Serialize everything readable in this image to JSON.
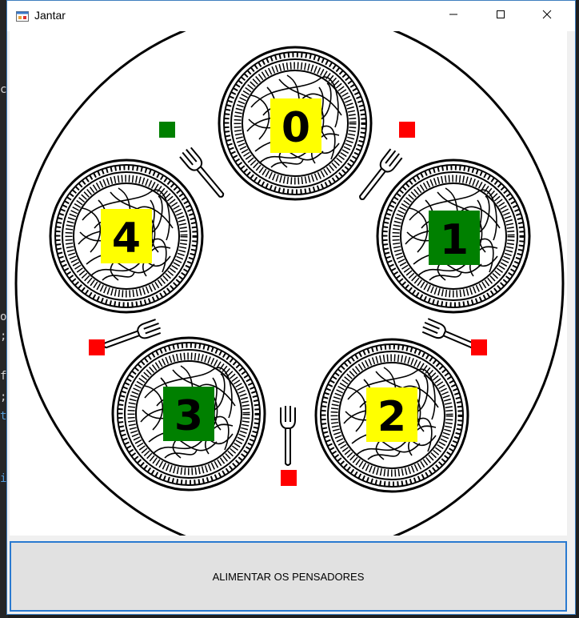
{
  "window": {
    "title": "Jantar",
    "app_icon": "winforms-app-icon",
    "controls": [
      "minimize-icon",
      "maximize-icon",
      "close-icon"
    ]
  },
  "background_editor": {
    "visible_chars": [
      "c",
      "o",
      ";",
      "f",
      ";",
      "t",
      "i"
    ]
  },
  "table": {
    "philosophers": [
      {
        "id": "0",
        "label": "0",
        "state_color": "#ffff00",
        "text_color": "#000000"
      },
      {
        "id": "1",
        "label": "1",
        "state_color": "#008000",
        "text_color": "#000000"
      },
      {
        "id": "2",
        "label": "2",
        "state_color": "#ffff00",
        "text_color": "#000000"
      },
      {
        "id": "3",
        "label": "3",
        "state_color": "#008000",
        "text_color": "#000000"
      },
      {
        "id": "4",
        "label": "4",
        "state_color": "#ffff00",
        "text_color": "#000000"
      }
    ],
    "forks": [
      {
        "id": "fork-0-4",
        "status_color": "#008000"
      },
      {
        "id": "fork-0-1",
        "status_color": "#ff0000"
      },
      {
        "id": "fork-1-2",
        "status_color": "#ff0000"
      },
      {
        "id": "fork-2-3",
        "status_color": "#ff0000"
      },
      {
        "id": "fork-3-4",
        "status_color": "#ff0000"
      }
    ]
  },
  "feed_button": {
    "label": "ALIMENTAR OS PENSADORES"
  }
}
